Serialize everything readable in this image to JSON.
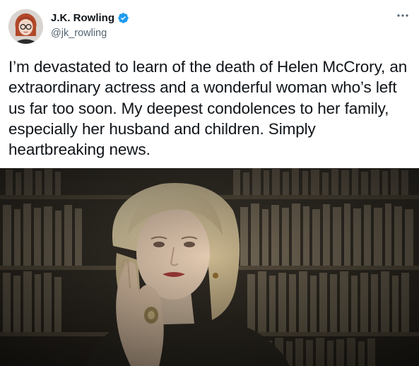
{
  "author": {
    "display_name": "J.K. Rowling",
    "handle": "@jk_rowling",
    "verified": true,
    "avatar_icon": "avatar-portrait"
  },
  "tweet": {
    "text": "I’m devastated to learn of the death of Helen McCrory, an extraordinary actress and a wonderful woman who’s left us far too soon. My deepest condolences to her family, especially her husband and children. Simply heartbreaking news."
  },
  "icons": {
    "verified": "verified-badge-icon",
    "more": "more-options-icon"
  },
  "colors": {
    "verified_blue": "#1d9bf0",
    "secondary_text": "#536471",
    "primary_text": "#0f1419"
  }
}
